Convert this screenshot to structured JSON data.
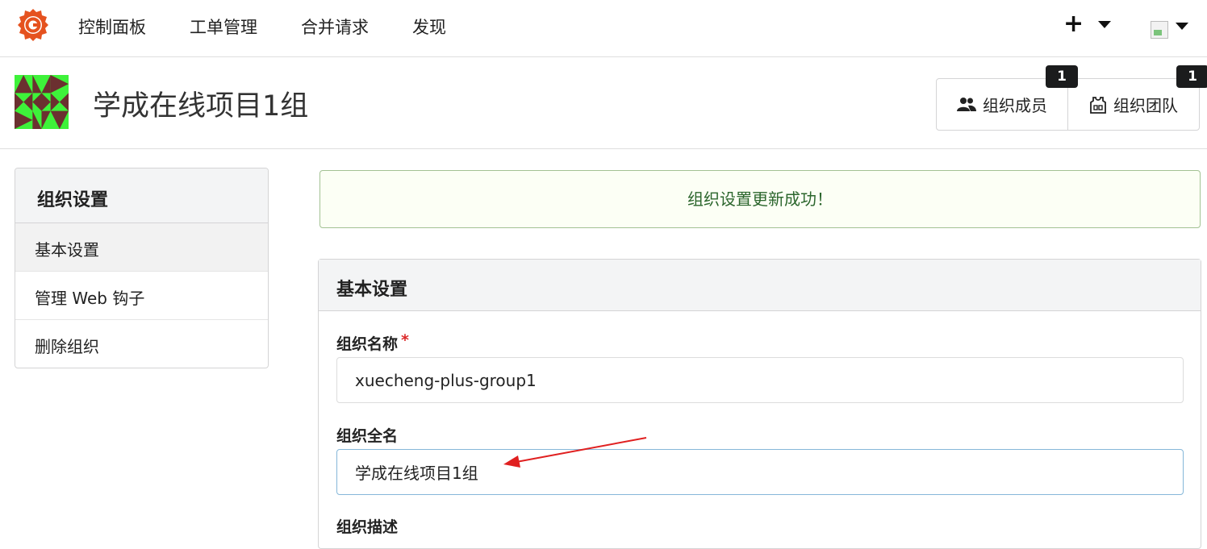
{
  "nav": {
    "items": [
      "控制面板",
      "工单管理",
      "合并请求",
      "发现"
    ],
    "plus_label": "+"
  },
  "org": {
    "title": "学成在线项目1组",
    "members_label": "组织成员",
    "members_count": "1",
    "teams_label": "组织团队",
    "teams_count": "1"
  },
  "sidebar": {
    "header": "组织设置",
    "items": [
      {
        "label": "基本设置",
        "active": true
      },
      {
        "label": "管理 Web 钩子",
        "active": false
      },
      {
        "label": "删除组织",
        "active": false
      }
    ]
  },
  "message": {
    "text": "组织设置更新成功！"
  },
  "form": {
    "title": "基本设置",
    "name_label": "组织名称",
    "required_mark": "*",
    "name_value": "xuecheng-plus-group1",
    "fullname_label": "组织全名",
    "fullname_value": "学成在线项目1组",
    "description_label": "组织描述"
  },
  "colors": {
    "accent_logo": "#e5521f",
    "success_text": "#2c662d",
    "success_border": "#a3c293",
    "annotation_arrow": "#e02020",
    "identicon_fg": "#6b3030",
    "identicon_bg": "#3ef23a"
  }
}
